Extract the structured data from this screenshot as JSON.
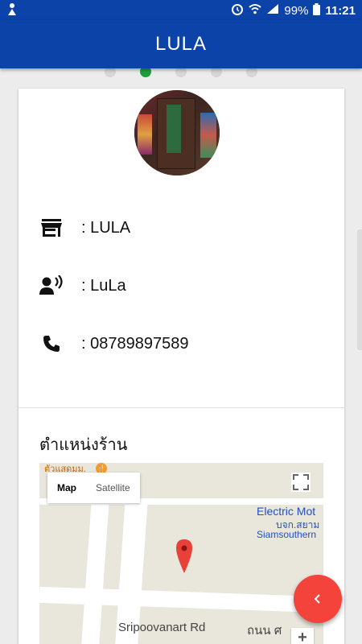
{
  "status_bar": {
    "battery_percent": "99%",
    "time": "11:21"
  },
  "app_bar": {
    "title": "LULA"
  },
  "pager": {
    "count": 5,
    "active_index": 1
  },
  "shop": {
    "name": ": LULA",
    "contact": ": LuLa",
    "phone": ": 08789897589"
  },
  "location": {
    "title": "ตำแหน่งร้าน",
    "map_button": "Map",
    "satellite_button": "Satellite",
    "label_top": "ตัวแสดมม.",
    "label_business_1": "Electric Mot",
    "label_business_2": "บจก.สยาม",
    "label_business_3": "Siamsouthern",
    "road_label": "Sripoovanart Rd",
    "road_label_thai": "ถนน ศ",
    "zoom_in": "+"
  },
  "fab": {
    "icon": "chevron-left-icon"
  },
  "colors": {
    "primary": "#0b43a8",
    "accent": "#f4433b",
    "active_dot": "#1f9e3d"
  }
}
